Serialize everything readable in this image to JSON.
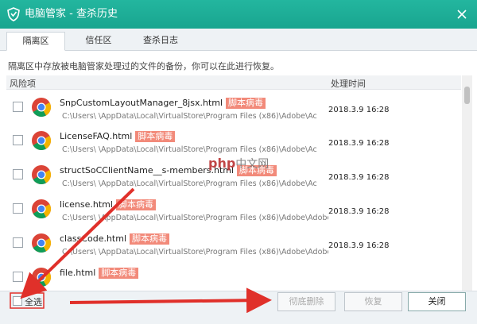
{
  "window": {
    "title": "电脑管家 - 查杀历史"
  },
  "tabs": [
    {
      "label": "隔离区",
      "active": true
    },
    {
      "label": "信任区",
      "active": false
    },
    {
      "label": "查杀日志",
      "active": false
    }
  ],
  "description": "隔离区中存放被电脑管家处理过的文件的备份，你可以在此进行恢复。",
  "table": {
    "headers": {
      "risk": "风险项",
      "time": "处理时间"
    },
    "rows": [
      {
        "name": "SnpCustomLayoutManager_8jsx.html",
        "badge": "脚本病毒",
        "path": "C:\\Users\\        \\AppData\\Local\\VirtualStore\\Program Files (x86)\\Adobe\\Ac",
        "time": "2018.3.9 16:28"
      },
      {
        "name": "LicenseFAQ.html",
        "badge": "脚本病毒",
        "path": "C:\\Users\\        \\AppData\\Local\\VirtualStore\\Program Files (x86)\\Adobe\\Ac",
        "time": "2018.3.9 16:28"
      },
      {
        "name": "structSoCClientName__s-members.html",
        "badge": "脚本病毒",
        "path": "C:\\Users\\        \\AppData\\Local\\VirtualStore\\Program Files (x86)\\Adobe\\Ac",
        "time": "2018.3.9 16:28"
      },
      {
        "name": "license.html",
        "badge": "脚本病毒",
        "path": "C:\\Users\\        \\AppData\\Local\\VirtualStore\\Program Files (x86)\\Adobe\\Adobe P",
        "time": "2018.3.9 16:28"
      },
      {
        "name": "classCode.html",
        "badge": "脚本病毒",
        "path": "C:\\Users\\        \\AppData\\Local\\VirtualStore\\Program Files (x86)\\Adobe\\Adobe P",
        "time": "2018.3.9 16:28"
      },
      {
        "name": "file.html",
        "badge": "脚本病毒",
        "path": "",
        "time": ""
      }
    ]
  },
  "footer": {
    "select_all": "全选",
    "delete_label": "彻底删除",
    "restore_label": "恢复",
    "close_label": "关闭"
  },
  "watermark": {
    "latin": "php",
    "cn": "中文网"
  },
  "colors": {
    "titlebar": "#1faf98",
    "badge": "#f28a7a",
    "arrow": "#e0302a"
  },
  "icons": {
    "logo": "shield-icon",
    "close": "close-icon",
    "file": "chrome-icon"
  }
}
